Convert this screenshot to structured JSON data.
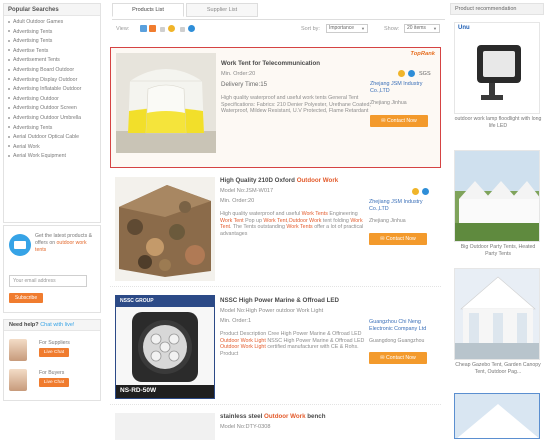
{
  "sidebar": {
    "popular_title": "Popular Searches",
    "items": [
      "Adult Outdoor Games",
      "Advertising Tents",
      "Advertising Tents",
      "Advertise Tents",
      "Advertisement Tents",
      "Advertising Board Outdoor",
      "Advertising Display Outdoor",
      "Advertising Inflatable Outdoor",
      "Advertising Outdoor",
      "Advertising Outdoor Screen",
      "Advertising Outdoor Umbrella",
      "Advertising Tents",
      "Aerial Outdoor Optical Cable",
      "Aerial Work",
      "Aerial Work Equipment"
    ],
    "subscribe": {
      "text": "Get the latest products & offers on",
      "link": "outdoor work tents",
      "placeholder": "Your email address",
      "button": "Subscribe"
    },
    "help": {
      "title": "Need help?",
      "title_sub": "Chat with live!",
      "suppliers_label": "For Suppliers",
      "buyers_label": "For Buyers",
      "chat_label": "Live Chat"
    }
  },
  "tabs": [
    {
      "label": "Products List",
      "active": true
    },
    {
      "label": "Supplier List",
      "active": false
    }
  ],
  "toolbar": {
    "view_label": "View:",
    "sort_label": "Sort by:",
    "sort_value": "Importance",
    "show_label": "Show:",
    "show_value": "20 items"
  },
  "listings": [
    {
      "title": "Work Tent for Telecommunication",
      "title_hl": "",
      "meta1": "Min. Order:20",
      "meta2": "Delivery Time:15",
      "desc": "High quality waterproof and useful work tents General Tent Specifications: Fabrics: 210 Denier Polyester, Urethane Coated, Waterproof, Mildew Resistant, U.V Protected, Flame Retardant",
      "supplier": "Zhejang JSM Industry Co.,LTD",
      "location": "Zhejiang Jinhua",
      "contact": "Contact Now",
      "toprank": "TopRank",
      "sgs": "SGS"
    },
    {
      "title": "High Quality 210D Oxford",
      "title_hl": "Outdoor Work",
      "meta1": "Model No:JSM-W017",
      "meta2": "Min. Order:20",
      "desc_a": "High quality waterproof and useful",
      "desc_b": "Work Tents",
      "desc_c": "Engineering",
      "desc_d": "Work Tent",
      "desc_e": "Pop up",
      "desc_f": "Work Tent",
      "desc_g": "Outdoor Work",
      "desc_h": "tent folding",
      "desc_i": "Work Tent",
      "desc_j": "The Tents outstanding",
      "desc_k": "Work Tents",
      "desc_l": "offer a lot of practical advantages",
      "supplier": "Zhejiang JSM Industry Co.,LTD",
      "location": "Zhejiang Jinhua",
      "contact": "Contact Now"
    },
    {
      "title": "NSSC High Power Marine & Offroad LED",
      "meta1": "Model No:High Power outdoor Work Light",
      "meta2": "Min. Order:1",
      "desc_a": "Product Description   Cree High Power Marine & Offroad LED",
      "desc_b": "Outdoor Work Light",
      "desc_c": "NSSC High Power Marine & Offroad LED",
      "desc_d": "Outdoor Work Light",
      "desc_e": "certified manufacturer with CE & Rohs.  Product",
      "supplier": "Guangzhou Chi Neng Electronic Company Ltd",
      "location": "Guangdong Guangzhou",
      "contact": "Contact Now",
      "thumb_brand": "NSSC GROUP",
      "thumb_model": "NS-RD-50W"
    },
    {
      "title": "stainless steel",
      "title_hl": "Outdoor Work",
      "title_tail": "bench",
      "meta1": "Model No:DTY-0308"
    }
  ],
  "right": {
    "title": "Product recommendation",
    "items": [
      {
        "caption": "outdoor work lamp floodlight with long life LED",
        "brand": "Unu"
      },
      {
        "caption": "Big Outdoor Party Tents, Heated Party Tents"
      },
      {
        "caption": "Cheap Gazebo Tent, Garden Canopy Tent, Outdoor Pag..."
      },
      {
        "caption": ""
      }
    ]
  }
}
